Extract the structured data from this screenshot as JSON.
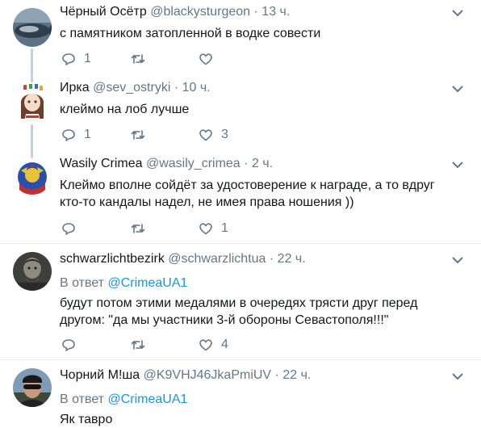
{
  "tweets": [
    {
      "name": "Чёрный Осётр",
      "handle": "@blackysturgeon",
      "time": "13 ч.",
      "text": "с памятником затопленной в водке совести",
      "replies": "1",
      "retweets": "",
      "likes": ""
    },
    {
      "name": "Ирка",
      "handle": "@sev_ostryki",
      "time": "10 ч.",
      "text": "клеймо на лоб лучше",
      "replies": "1",
      "retweets": "",
      "likes": "3"
    },
    {
      "name": "Wasily Crimea",
      "handle": "@wasily_crimea",
      "time": "2 ч.",
      "text_line1": "Клеймо вполне сойдёт за удостоверение к награде, а то вдруг",
      "text_line2": "кто-то кандалы надел, не имея права ношения ))",
      "replies": "",
      "retweets": "",
      "likes": "1"
    },
    {
      "name": "schwarzlichtbezirk",
      "handle": "@schwarzlichtua",
      "time": "22 ч.",
      "reply_prefix": "В ответ",
      "reply_mention": "@CrimeaUA1",
      "text_line1": "будут потом этими медалями в очередях трясти друг перед",
      "text_line2": "другом: \"да мы участники 3-й обороны Севастополя!!!\"",
      "replies": "",
      "retweets": "",
      "likes": "4"
    },
    {
      "name": "Чорний М!ша",
      "handle": "@K9VHJ46JkaPmiUV",
      "time": "22 ч.",
      "reply_prefix": "В ответ",
      "reply_mention": "@CrimeaUA1",
      "text": "Як тавро"
    }
  ],
  "dot": "·",
  "icons": [
    "reply-icon",
    "retweet-icon",
    "like-icon",
    "chevron-down-icon"
  ],
  "colors": {
    "text": "#14171a",
    "secondary": "#657786",
    "link": "#1b95e0",
    "thread": "#c4cfd6",
    "divider": "#e6ecf0"
  }
}
